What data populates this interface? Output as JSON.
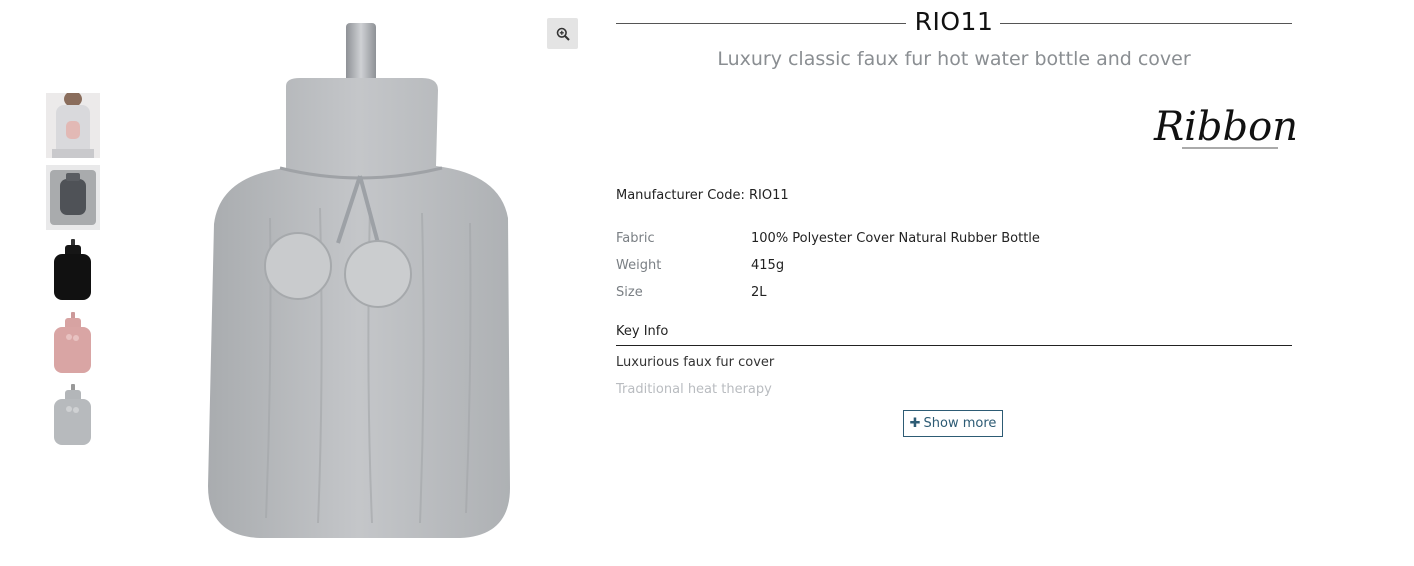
{
  "product": {
    "code": "RIO11",
    "subtitle": "Luxury classic faux fur hot water bottle and cover",
    "brand": "Ribbon",
    "manufacturer_code": "Manufacturer Code: RIO11"
  },
  "gallery": {
    "thumbnails": [
      {
        "name": "model-holding-bottle",
        "color": "#cfcfd3"
      },
      {
        "name": "bottle-on-fur-rug",
        "color": "#6d6f74"
      },
      {
        "name": "black-fur-bottle",
        "color": "#1b1b1b"
      },
      {
        "name": "pink-fur-bottle",
        "color": "#d8a4a4"
      },
      {
        "name": "grey-fur-bottle",
        "color": "#b5b8bb"
      }
    ],
    "main_color": "#b9bcbf",
    "zoom_icon": "zoom-in-icon"
  },
  "specs": [
    {
      "label": "Fabric",
      "value": "100% Polyester Cover Natural Rubber Bottle"
    },
    {
      "label": "Weight",
      "value": "415g"
    },
    {
      "label": "Size",
      "value": "2L"
    }
  ],
  "key_info": {
    "heading": "Key Info",
    "items": [
      "Luxurious faux fur cover",
      "Traditional heat therapy"
    ]
  },
  "show_more": {
    "icon": "plus-icon",
    "label": "Show more"
  },
  "colors": {
    "accent": "#2d5b74",
    "muted_text": "#8a8e92"
  }
}
